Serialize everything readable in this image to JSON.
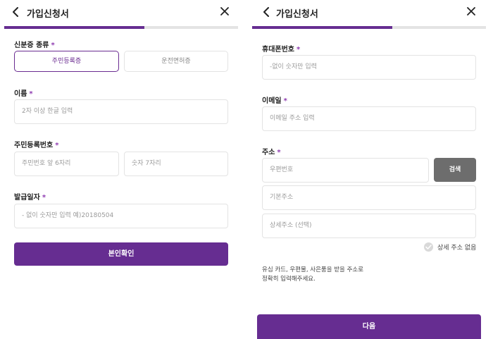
{
  "left": {
    "header": {
      "title": "가입신청서"
    },
    "progress": {
      "fraction": 0.6
    },
    "id_type": {
      "label": "신분증 종류",
      "required": "*",
      "options": [
        "주민등록증",
        "운전면허증"
      ],
      "selected": 0
    },
    "name": {
      "label": "이름",
      "required": "*",
      "placeholder": "2자 이상 한글 입력"
    },
    "rrn": {
      "label": "주민등록번호",
      "required": "*",
      "front_placeholder": "주민번호 앞 6자리",
      "back_placeholder": "숫자 7자리"
    },
    "issue_date": {
      "label": "발급일자",
      "required": "*",
      "placeholder": "- 없이 숫자만 입력  예)20180504"
    },
    "verify_button": "본인확인"
  },
  "right": {
    "header": {
      "title": "가입신청서"
    },
    "progress": {
      "fraction": 0.6
    },
    "phone": {
      "label": "휴대폰번호",
      "required": "*",
      "placeholder": "-없이 숫자만 입력"
    },
    "email": {
      "label": "이메일",
      "required": "*",
      "placeholder": "이메일 주소 입력"
    },
    "address": {
      "label": "주소",
      "required": "*",
      "zip_placeholder": "우편번호",
      "search_button": "검색",
      "base_placeholder": "기본주소",
      "detail_placeholder": "상세주소 (선택)",
      "no_detail_label": "상세 주소 없음"
    },
    "notice": [
      "유심 카드, 우편물, 사은품을 받을 주소로",
      "정확히 입력해주세요."
    ],
    "next_button": "다음"
  },
  "colors": {
    "brand": "#662d91",
    "gray_button": "#6d6d6d",
    "track": "#e4e4e4"
  },
  "icons": [
    "chevron-left-icon",
    "close-icon",
    "check-circle-icon"
  ]
}
